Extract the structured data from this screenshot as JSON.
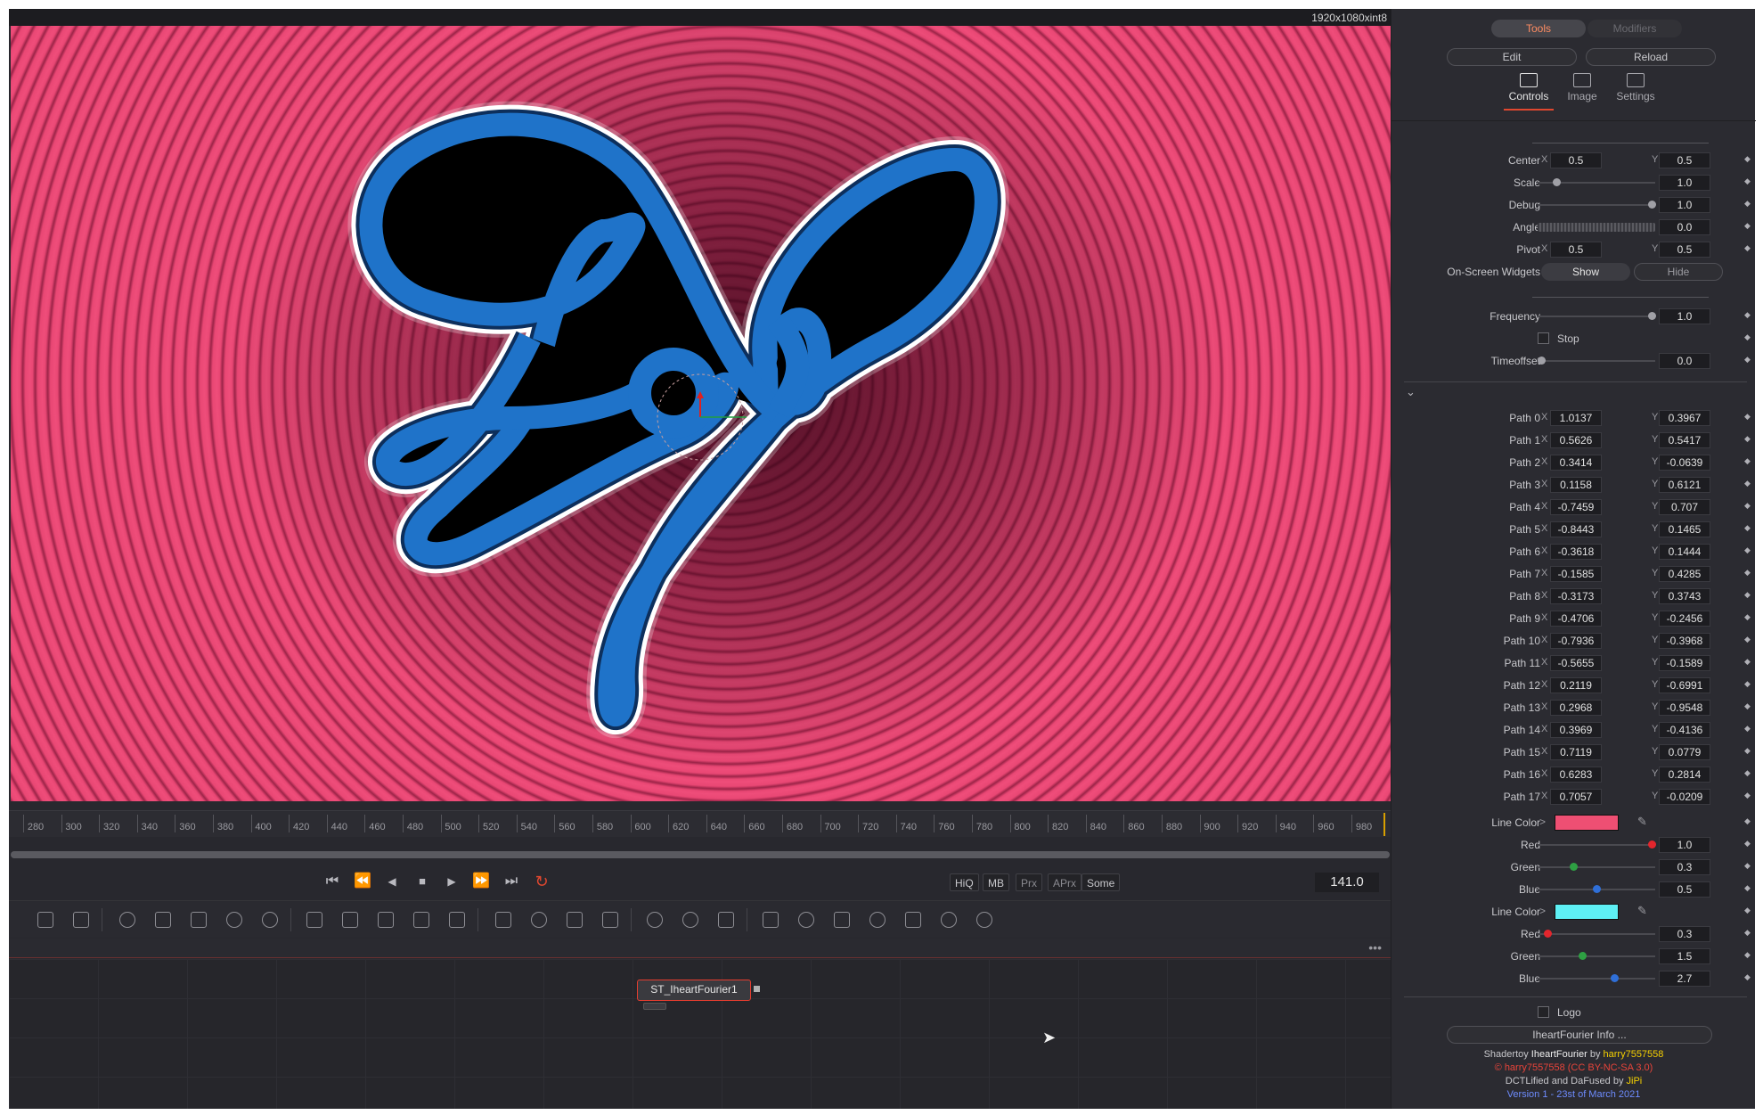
{
  "viewer": {
    "resolution": "1920x1080xint8"
  },
  "timeline": {
    "ticks": [
      "280",
      "300",
      "320",
      "340",
      "360",
      "380",
      "400",
      "420",
      "440",
      "460",
      "480",
      "500",
      "520",
      "540",
      "560",
      "580",
      "600",
      "620",
      "640",
      "660",
      "680",
      "700",
      "720",
      "740",
      "760",
      "780",
      "800",
      "820",
      "840",
      "860",
      "880",
      "900",
      "920",
      "940",
      "960",
      "980"
    ],
    "current_frame": "141.0"
  },
  "transport": {
    "go_start": "⏮",
    "step_back": "⏪",
    "play_reverse": "◀",
    "stop": "■",
    "play": "▶",
    "step_forward": "⏩",
    "go_end": "⏭",
    "loop": "↻",
    "quality": [
      "HiQ",
      "MB",
      "Prx",
      "APrx",
      "Some"
    ]
  },
  "node": {
    "name": "ST_IheartFourier1"
  },
  "node_more": "•••",
  "inspector": {
    "tabs_top": {
      "tools": "Tools",
      "modifiers": "Modifiers"
    },
    "edit": "Edit",
    "reload": "Reload",
    "tabs": [
      "Controls",
      "Image",
      "Settings"
    ],
    "center": {
      "label": "Center",
      "x": "0.5",
      "y": "0.5"
    },
    "scale": {
      "label": "Scale",
      "value": "1.0"
    },
    "debug": {
      "label": "Debug",
      "value": "1.0"
    },
    "angle": {
      "label": "Angle",
      "value": "0.0"
    },
    "pivot": {
      "label": "Pivot",
      "x": "0.5",
      "y": "0.5"
    },
    "widgets": {
      "label": "On-Screen Widgets",
      "show": "Show",
      "hide": "Hide"
    },
    "frequency": {
      "label": "Frequency",
      "value": "1.0"
    },
    "stop": {
      "label": "Stop"
    },
    "timeoffset": {
      "label": "Timeoffset",
      "value": "0.0"
    },
    "axis_x": "X",
    "axis_y": "Y",
    "paths": [
      {
        "label": "Path 0",
        "x": "1.0137",
        "y": "0.3967"
      },
      {
        "label": "Path 1",
        "x": "0.5626",
        "y": "0.5417"
      },
      {
        "label": "Path 2",
        "x": "0.3414",
        "y": "-0.0639"
      },
      {
        "label": "Path 3",
        "x": "0.1158",
        "y": "0.6121"
      },
      {
        "label": "Path 4",
        "x": "-0.7459",
        "y": "0.707"
      },
      {
        "label": "Path 5",
        "x": "-0.8443",
        "y": "0.1465"
      },
      {
        "label": "Path 6",
        "x": "-0.3618",
        "y": "0.1444"
      },
      {
        "label": "Path 7",
        "x": "-0.1585",
        "y": "0.4285"
      },
      {
        "label": "Path 8",
        "x": "-0.3173",
        "y": "0.3743"
      },
      {
        "label": "Path 9",
        "x": "-0.4706",
        "y": "-0.2456"
      },
      {
        "label": "Path 10",
        "x": "-0.7936",
        "y": "-0.3968"
      },
      {
        "label": "Path 11",
        "x": "-0.5655",
        "y": "-0.1589"
      },
      {
        "label": "Path 12",
        "x": "0.2119",
        "y": "-0.6991"
      },
      {
        "label": "Path 13",
        "x": "0.2968",
        "y": "-0.9548"
      },
      {
        "label": "Path 14",
        "x": "0.3969",
        "y": "-0.4136"
      },
      {
        "label": "Path 15",
        "x": "0.7119",
        "y": "0.0779"
      },
      {
        "label": "Path 16",
        "x": "0.6283",
        "y": "0.2814"
      },
      {
        "label": "Path 17",
        "x": "0.7057",
        "y": "-0.0209"
      }
    ],
    "line_color_1": {
      "label": "Line Color",
      "swatch": "#ee4f73",
      "red": {
        "label": "Red",
        "value": "1.0"
      },
      "green": {
        "label": "Green",
        "value": "0.3"
      },
      "blue": {
        "label": "Blue",
        "value": "0.5"
      }
    },
    "line_color_2": {
      "label": "Line Color",
      "swatch": "#5ef0f4",
      "red": {
        "label": "Red",
        "value": "0.3"
      },
      "green": {
        "label": "Green",
        "value": "1.5"
      },
      "blue": {
        "label": "Blue",
        "value": "2.7"
      }
    },
    "logo": {
      "label": "Logo"
    },
    "info_button": "IheartFourier Info ...",
    "credits": {
      "line1_a": "Shadertoy ",
      "line1_b": "IheartFourier",
      "line1_c": " by ",
      "line1_d": "harry7557558",
      "line2": "© harry7557558 (CC BY-NC-SA 3.0)",
      "line3_a": "DCTLified and DaFused by ",
      "line3_b": "JiPi",
      "line4": "Version 1 - 23st of March 2021"
    }
  },
  "colors": {
    "accent": "#e0472f",
    "active_tab": "#ff8c62",
    "link_yellow": "#f5d000",
    "credit_red": "#e8443a",
    "credit_blue": "#6e8cff"
  }
}
